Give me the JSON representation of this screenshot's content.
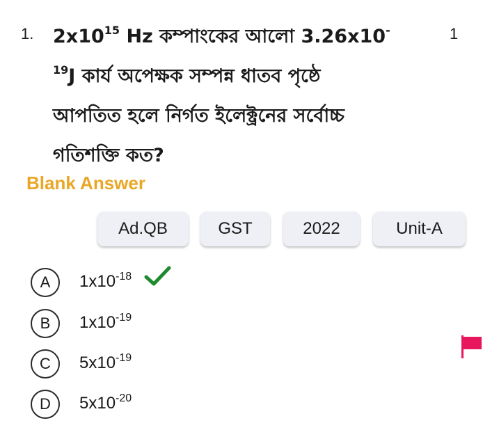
{
  "question": {
    "number": "1.",
    "marks": "1",
    "line1_a": "2x10",
    "line1_sup": "15",
    "line1_b": " Hz কম্পাংকের আলো 3.26x10",
    "line1_sup2": "-",
    "line2_sup": "19",
    "line2_b": "J কার্য অপেক্ষক সম্পন্ন ধাতব পৃষ্ঠে",
    "line3": "আপতিত হলে নির্গত ইলেক্ট্রনের সর্বোচ্চ",
    "line4": "গতিশক্তি কত?"
  },
  "answer_label": "Blank Answer",
  "tags": [
    "Ad.QB",
    "GST",
    "2022",
    "Unit-A"
  ],
  "options": [
    {
      "letter": "A",
      "base": "1x10",
      "exp": "-18",
      "correct": true
    },
    {
      "letter": "B",
      "base": "1x10",
      "exp": "-19",
      "correct": false
    },
    {
      "letter": "C",
      "base": "5x10",
      "exp": "-19",
      "correct": false
    },
    {
      "letter": "D",
      "base": "5x10",
      "exp": "-20",
      "correct": false
    }
  ],
  "colors": {
    "answer_label": "#e9a726",
    "correct_check": "#1e8a2e",
    "flag": "#e8175d",
    "tag_bg": "#eef0f6"
  },
  "icons": {
    "correct": "check-icon",
    "bookmark": "flag-icon"
  }
}
